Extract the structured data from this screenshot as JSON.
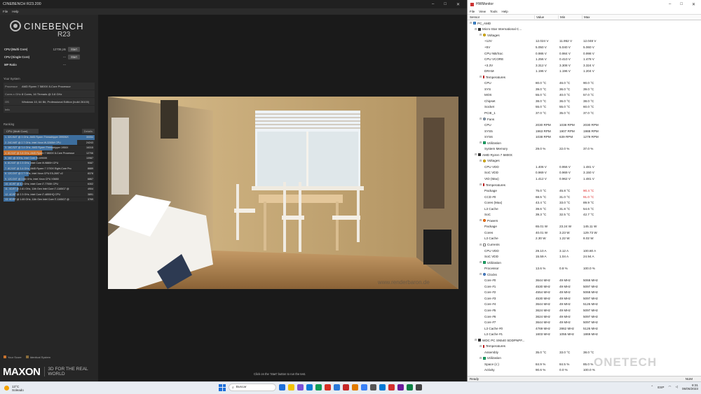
{
  "cinebench": {
    "title": "CINEBENCH R23.200",
    "menu": [
      "File",
      "Help"
    ],
    "logo_name": "CINEBENCH",
    "logo_version": "R23",
    "scores": [
      {
        "label": "CPU (Multi Core)",
        "value": "12706 pts",
        "button": "Start"
      },
      {
        "label": "CPU (Single Core)",
        "value": "---",
        "button": "Start"
      },
      {
        "label": "MP Ratio",
        "value": "---",
        "button": ""
      }
    ],
    "system_title": "Your System",
    "system": [
      {
        "key": "Processor",
        "value": "AMD Ryzen 7 5800X 8-Core Processor"
      },
      {
        "key": "Cores x GHz",
        "value": "8 Cores, 16 Threads @ 3.8 GHz"
      },
      {
        "key": "OS",
        "value": "Windows 10, 64 Bit, Professional Edition (build 26100)"
      },
      {
        "key": "Info",
        "value": ""
      }
    ],
    "ranking_title": "Ranking",
    "ranking_select": "CPU (Multi Core)",
    "ranking_details": "Details",
    "ranking": [
      {
        "text": "1. 32C/64T @ 3 GHz, AMD Ryzen Threadripper 3990WX",
        "score": "30054",
        "pct": 1.0,
        "highlight": false
      },
      {
        "text": "2. 24C/48T @ 2.7 GHz, Intel Xeon W-3265M CPU",
        "score": "24243",
        "pct": 0.81,
        "highlight": false
      },
      {
        "text": "3. 16C/32T @ 3.4 GHz, AMD Ryzen Threadripper 1950X",
        "score": "16315",
        "pct": 0.54,
        "highlight": false
      },
      {
        "text": "4. 8C/16T @ 3.8 GHz, AMD Ryzen 7 5800X 8-Core Processor",
        "score": "12706",
        "pct": 0.42,
        "highlight": true
      },
      {
        "text": "5. 16C @ 3GHz, Intel Core i9-10900K",
        "score": "10987",
        "pct": 0.37,
        "highlight": false
      },
      {
        "text": "6. 8C/16T @ 2.3 GHz, Intel Core i9-9880H CPU",
        "score": "9087",
        "pct": 0.3,
        "highlight": false
      },
      {
        "text": "7. 8C/16T @ 3.4 GHz, AMD Ryzen 7 1700X Eight-Core Pro",
        "score": "8889",
        "pct": 0.29,
        "highlight": false
      },
      {
        "text": "8. 12C/24T @ 2.7 GHz, Intel Xeon CPU E5-2697 v2",
        "score": "8378",
        "pct": 0.28,
        "highlight": false
      },
      {
        "text": "9. 12C/24T @ 2.66 GHz, Intel Xeon CPU X5650",
        "score": "6867",
        "pct": 0.23,
        "highlight": false
      },
      {
        "text": "10. 4C/8T @ 4.2 GHz, Intel Core i7-7700K CPU",
        "score": "6302",
        "pct": 0.21,
        "highlight": false
      },
      {
        "text": "11. 4C/8T @ 2.81 GHz, 11th Gen Intel Core i7-1165G7 @",
        "score": "4904",
        "pct": 0.16,
        "highlight": false
      },
      {
        "text": "12. 4C/8T @ 2.3 GHz, Intel Core i7-4850HQ CPU",
        "score": "3891",
        "pct": 0.13,
        "highlight": false
      },
      {
        "text": "13. 4C/8T @ 1.69 GHz, 11th Gen Intel Core i7-1165G7 @",
        "score": "3769",
        "pct": 0.125,
        "highlight": false
      }
    ],
    "legend": [
      {
        "label": "Your Score",
        "color": "#c8722e"
      },
      {
        "label": "Identical System",
        "color": "#8a6d3b"
      }
    ],
    "maxon": "MAXON",
    "maxon_tag": "3D FOR THE REAL WORLD",
    "hint": "Click on the 'Start' button to run the test.",
    "render_watermark": "www.renderbaron.de"
  },
  "hwmonitor": {
    "title": "HWMonitor",
    "menu": [
      "File",
      "View",
      "Tools",
      "Help"
    ],
    "columns": {
      "sensor": "Sensor",
      "value": "Value",
      "min": "Min",
      "max": "Max"
    },
    "rows": [
      {
        "level": 0,
        "icon": "pc",
        "name": "PC_AMD",
        "v": "",
        "mi": "",
        "ma": ""
      },
      {
        "level": 1,
        "icon": "chip",
        "name": "Micro-Star International C...",
        "v": "",
        "mi": "",
        "ma": ""
      },
      {
        "level": 2,
        "icon": "volt",
        "name": "Voltages",
        "v": "",
        "mi": "",
        "ma": ""
      },
      {
        "level": 3,
        "icon": "",
        "name": "+12V",
        "v": "12.024 V",
        "mi": "11.952 V",
        "ma": "12.048 V"
      },
      {
        "level": 3,
        "icon": "",
        "name": "+5V",
        "v": "5.050 V",
        "mi": "5.040 V",
        "ma": "5.060 V"
      },
      {
        "level": 3,
        "icon": "",
        "name": "CPU NB/Soc",
        "v": "0.986 V",
        "mi": "0.984 V",
        "ma": "0.998 V"
      },
      {
        "level": 3,
        "icon": "",
        "name": "CPU VCORE",
        "v": "1.256 V",
        "mi": "0.410 V",
        "ma": "1.478 V"
      },
      {
        "level": 3,
        "icon": "",
        "name": "+3.3V",
        "v": "3.312 V",
        "mi": "3.308 V",
        "ma": "3.324 V"
      },
      {
        "level": 3,
        "icon": "",
        "name": "DRAM",
        "v": "1.196 V",
        "mi": "1.196 V",
        "ma": "1.204 V"
      },
      {
        "level": 2,
        "icon": "temp",
        "name": "Temperatures",
        "v": "",
        "mi": "",
        "ma": ""
      },
      {
        "level": 3,
        "icon": "",
        "name": "CPU",
        "v": "80.0 °C",
        "mi": "46.0 °C",
        "ma": "90.0 °C"
      },
      {
        "level": 3,
        "icon": "",
        "name": "SYS",
        "v": "39.0 °C",
        "mi": "36.0 °C",
        "ma": "39.0 °C"
      },
      {
        "level": 3,
        "icon": "",
        "name": "MOS",
        "v": "55.0 °C",
        "mi": "40.0 °C",
        "ma": "57.0 °C"
      },
      {
        "level": 3,
        "icon": "",
        "name": "Chipset",
        "v": "38.0 °C",
        "mi": "36.0 °C",
        "ma": "38.0 °C"
      },
      {
        "level": 3,
        "icon": "",
        "name": "Socket",
        "v": "55.0 °C",
        "mi": "55.0 °C",
        "ma": "60.0 °C"
      },
      {
        "level": 3,
        "icon": "",
        "name": "PCIE_1",
        "v": "37.0 °C",
        "mi": "35.0 °C",
        "ma": "37.0 °C"
      },
      {
        "level": 2,
        "icon": "fan",
        "name": "Fans",
        "v": "",
        "mi": "",
        "ma": ""
      },
      {
        "level": 3,
        "icon": "",
        "name": "CPU",
        "v": "2030 RPM",
        "mi": "1038 RPM",
        "ma": "2030 RPM"
      },
      {
        "level": 3,
        "icon": "",
        "name": "SYS5",
        "v": "1963 RPM",
        "mi": "1907 RPM",
        "ma": "1988 RPM"
      },
      {
        "level": 3,
        "icon": "",
        "name": "SYS6",
        "v": "1038 RPM",
        "mi": "639 RPM",
        "ma": "1279 RPM"
      },
      {
        "level": 2,
        "icon": "util",
        "name": "Utilization",
        "v": "",
        "mi": "",
        "ma": ""
      },
      {
        "level": 3,
        "icon": "",
        "name": "System Memory",
        "v": "29.0 %",
        "mi": "22.0 %",
        "ma": "37.0 %"
      },
      {
        "level": 1,
        "icon": "chip",
        "name": "AMD Ryzen 7 5800X",
        "v": "",
        "mi": "",
        "ma": ""
      },
      {
        "level": 2,
        "icon": "volt",
        "name": "Voltages",
        "v": "",
        "mi": "",
        "ma": ""
      },
      {
        "level": 3,
        "icon": "",
        "name": "CPU VDD",
        "v": "1.406 V",
        "mi": "0.956 V",
        "ma": "1.481 V"
      },
      {
        "level": 3,
        "icon": "",
        "name": "SoC VDD",
        "v": "0.969 V",
        "mi": "0.969 V",
        "ma": "3.150 V"
      },
      {
        "level": 3,
        "icon": "",
        "name": "VID (Max)",
        "v": "1.412 V",
        "mi": "0.962 V",
        "ma": "1.481 V"
      },
      {
        "level": 2,
        "icon": "temp",
        "name": "Temperatures",
        "v": "",
        "mi": "",
        "ma": ""
      },
      {
        "level": 3,
        "icon": "",
        "name": "Package",
        "v": "75.0 °C",
        "mi": "45.8 °C",
        "ma": "90.4 °C",
        "hot": true
      },
      {
        "level": 3,
        "icon": "",
        "name": "CCD #0",
        "v": "68.5 °C",
        "mi": "31.0 °C",
        "ma": "91.0 °C",
        "hot": true
      },
      {
        "level": 3,
        "icon": "",
        "name": "Cores (Max)",
        "v": "43.4 °C",
        "mi": "33.0 °C",
        "ma": "89.9 °C"
      },
      {
        "level": 3,
        "icon": "",
        "name": "L3 Cache",
        "v": "39.6 °C",
        "mi": "31.8 °C",
        "ma": "54.6 °C"
      },
      {
        "level": 3,
        "icon": "",
        "name": "SoC",
        "v": "39.3 °C",
        "mi": "32.5 °C",
        "ma": "42.7 °C"
      },
      {
        "level": 2,
        "icon": "power",
        "name": "Powers",
        "v": "",
        "mi": "",
        "ma": ""
      },
      {
        "level": 3,
        "icon": "",
        "name": "Package",
        "v": "65.01 W",
        "mi": "23.24 W",
        "ma": "145.11 W"
      },
      {
        "level": 3,
        "icon": "",
        "name": "Cores",
        "v": "40.01 W",
        "mi": "3.23 W",
        "ma": "129.73 W"
      },
      {
        "level": 3,
        "icon": "",
        "name": "L3 Cache",
        "v": "2.30 W",
        "mi": "1.22 W",
        "ma": "8.02 W"
      },
      {
        "level": 2,
        "icon": "curr",
        "name": "Currents",
        "v": "",
        "mi": "",
        "ma": ""
      },
      {
        "level": 3,
        "icon": "",
        "name": "CPU VDD",
        "v": "29.10 A",
        "mi": "3.12 A",
        "ma": "100.80 A"
      },
      {
        "level": 3,
        "icon": "",
        "name": "SoC VDD",
        "v": "15.59 A",
        "mi": "1.04 A",
        "ma": "24.94 A"
      },
      {
        "level": 2,
        "icon": "util",
        "name": "Utilization",
        "v": "",
        "mi": "",
        "ma": ""
      },
      {
        "level": 3,
        "icon": "",
        "name": "Processor",
        "v": "13.6 %",
        "mi": "0.8 %",
        "ma": "100.0 %"
      },
      {
        "level": 2,
        "icon": "clock",
        "name": "Clocks",
        "v": "",
        "mi": "",
        "ma": ""
      },
      {
        "level": 3,
        "icon": "",
        "name": "Core #0",
        "v": "3644 MHz",
        "mi": "49 MHz",
        "ma": "5068 MHz"
      },
      {
        "level": 3,
        "icon": "",
        "name": "Core #1",
        "v": "4530 MHz",
        "mi": "49 MHz",
        "ma": "5097 MHz"
      },
      {
        "level": 3,
        "icon": "",
        "name": "Core #2",
        "v": "4554 MHz",
        "mi": "49 MHz",
        "ma": "5068 MHz"
      },
      {
        "level": 3,
        "icon": "",
        "name": "Core #3",
        "v": "4530 MHz",
        "mi": "49 MHz",
        "ma": "5097 MHz"
      },
      {
        "level": 3,
        "icon": "",
        "name": "Core #4",
        "v": "3644 MHz",
        "mi": "49 MHz",
        "ma": "5126 MHz"
      },
      {
        "level": 3,
        "icon": "",
        "name": "Core #5",
        "v": "3624 MHz",
        "mi": "49 MHz",
        "ma": "5097 MHz"
      },
      {
        "level": 3,
        "icon": "",
        "name": "Core #6",
        "v": "3624 MHz",
        "mi": "49 MHz",
        "ma": "5097 MHz"
      },
      {
        "level": 3,
        "icon": "",
        "name": "Core #7",
        "v": "3644 MHz",
        "mi": "49 MHz",
        "ma": "5097 MHz"
      },
      {
        "level": 3,
        "icon": "",
        "name": "L3 Cache #0",
        "v": "4769 MHz",
        "mi": "2862 MHz",
        "ma": "5126 MHz"
      },
      {
        "level": 3,
        "icon": "",
        "name": "L3 Cache #1",
        "v": "1603 MHz",
        "mi": "1055 MHz",
        "ma": "1869 MHz"
      },
      {
        "level": 1,
        "icon": "chip",
        "name": "WDC PC SN540 SDDPNPF...",
        "v": "",
        "mi": "",
        "ma": ""
      },
      {
        "level": 2,
        "icon": "temp",
        "name": "Temperatures",
        "v": "",
        "mi": "",
        "ma": ""
      },
      {
        "level": 3,
        "icon": "",
        "name": "Assembly",
        "v": "35.0 °C",
        "mi": "33.0 °C",
        "ma": "38.0 °C"
      },
      {
        "level": 2,
        "icon": "util",
        "name": "Utilization",
        "v": "",
        "mi": "",
        "ma": ""
      },
      {
        "level": 3,
        "icon": "",
        "name": "Space (c:)",
        "v": "84.9 %",
        "mi": "84.5 %",
        "ma": "85.0 %"
      },
      {
        "level": 3,
        "icon": "",
        "name": "Activity",
        "v": "90.6 %",
        "mi": "0.0 %",
        "ma": "100.0 %"
      }
    ],
    "status_left": "Ready",
    "status_right": "NUM",
    "watermark": "ONETECH"
  },
  "taskbar": {
    "weather_temp": "13°C",
    "weather_desc": "Soleado",
    "search_placeholder": "Buscar",
    "lang": "ESP",
    "time": "8:31",
    "date": "06/06/2023",
    "app_colors": [
      "#1e6fd9",
      "#f2c200",
      "#7b4fd6",
      "#0a7bd6",
      "#0f9d58",
      "#d93025",
      "#2b79d9",
      "#c62828",
      "#e07b00",
      "#3b82f6",
      "#555555",
      "#0078d4",
      "#d32f2f",
      "#6a1b9a",
      "#0b8043",
      "#444444"
    ]
  }
}
